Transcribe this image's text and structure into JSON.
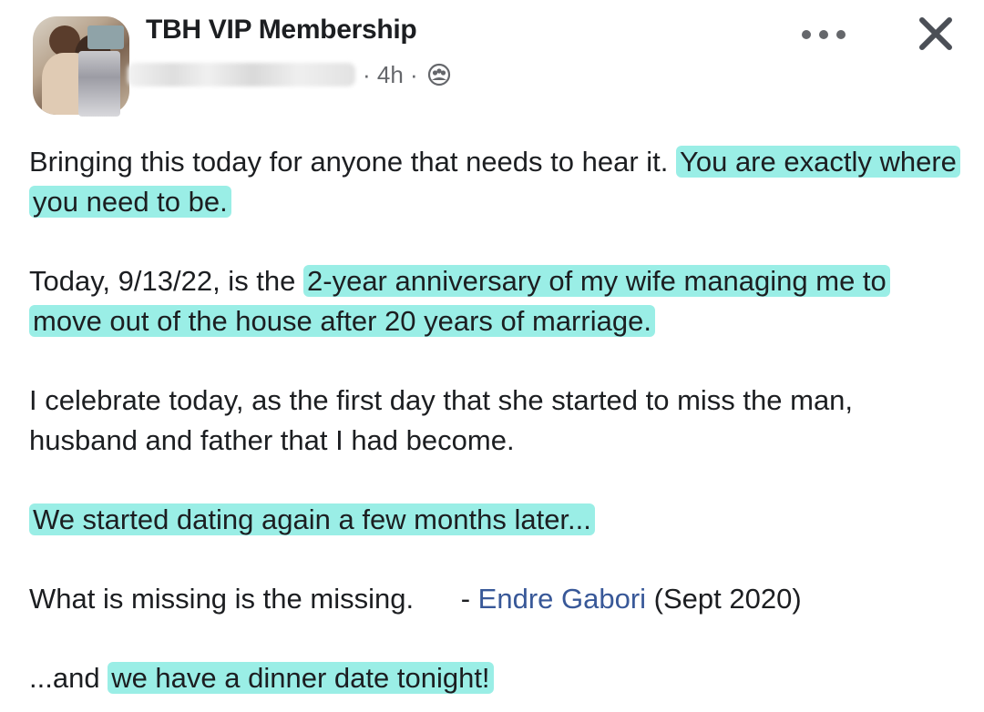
{
  "header": {
    "group_name": "TBH VIP Membership",
    "time": "· 4h ·",
    "audience_icon": "group-members-icon"
  },
  "actions": {
    "more_icon": "more-dots-icon",
    "close_icon": "close-icon"
  },
  "post": {
    "p1_plain": "Bringing this today for anyone that needs to hear it.   ",
    "p1_highlight": "You are exactly where you need to be.",
    "p2_start": "Today, 9/13/22, is the ",
    "p2_highlight": "2-year anniversary of my wife managing me to move out of the house after 20 years of marriage.",
    "p3": "I celebrate today, as the first day that she started to miss the man, husband and father that I had become.",
    "p4_highlight": "We started dating again a few months later...",
    "p5_start": "What is missing is the missing.      - ",
    "p5_link": "Endre Gabori",
    "p5_end": " (Sept 2020)",
    "p6_start": "...and ",
    "p6_highlight": "we have a dinner date tonight!"
  },
  "colors": {
    "highlight": "#78e8de",
    "link": "#385898",
    "meta": "#65676b"
  }
}
